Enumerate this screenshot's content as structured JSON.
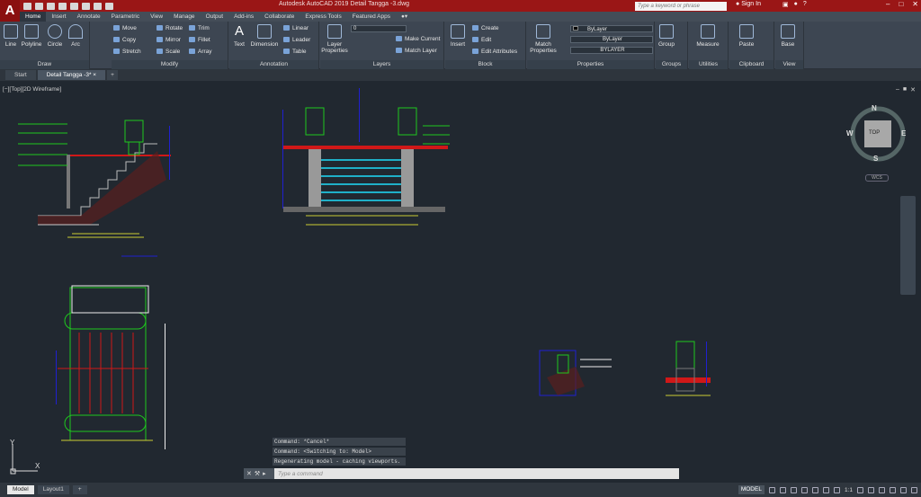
{
  "app": {
    "logo": "A",
    "title": "Autodesk AutoCAD 2019   Detail Tangga -3.dwg",
    "search_placeholder": "Type a keyword or phrase",
    "sign_in": "Sign In"
  },
  "ribbon_tabs": [
    "Home",
    "Insert",
    "Annotate",
    "Parametric",
    "View",
    "Manage",
    "Output",
    "Add-ins",
    "Collaborate",
    "Express Tools",
    "Featured Apps"
  ],
  "draw": {
    "label": "Draw",
    "line": "Line",
    "polyline": "Polyline",
    "circle": "Circle",
    "arc": "Arc"
  },
  "modify": {
    "label": "Modify",
    "move": "Move",
    "rotate": "Rotate",
    "trim": "Trim",
    "copy": "Copy",
    "mirror": "Mirror",
    "fillet": "Fillet",
    "stretch": "Stretch",
    "scale": "Scale",
    "array": "Array"
  },
  "annotation": {
    "label": "Annotation",
    "text": "Text",
    "dimension": "Dimension",
    "linear": "Linear",
    "leader": "Leader",
    "table": "Table"
  },
  "layers": {
    "label": "Layers",
    "properties": "Layer Properties",
    "current_layer": "0",
    "make_current": "Make Current",
    "match_layer": "Match Layer"
  },
  "block": {
    "label": "Block",
    "insert": "Insert",
    "create": "Create",
    "edit": "Edit",
    "edit_attributes": "Edit Attributes"
  },
  "properties": {
    "label": "Properties",
    "match": "Match Properties",
    "color": "ByLayer",
    "linetype": "ByLayer",
    "lineweight": "BYLAYER"
  },
  "groups": {
    "label": "Groups",
    "group": "Group"
  },
  "utilities": {
    "label": "Utilities",
    "measure": "Measure"
  },
  "clipboard": {
    "label": "Clipboard",
    "paste": "Paste"
  },
  "view": {
    "label": "View",
    "base": "Base"
  },
  "doc_tabs": {
    "start": "Start",
    "active": "Detail Tangga -3*"
  },
  "viewport": {
    "label": "[−][Top][2D Wireframe]",
    "cube_top": "TOP",
    "n": "N",
    "s": "S",
    "e": "E",
    "w": "W",
    "wcs": "WCS"
  },
  "command": {
    "history": [
      "Command: *Cancel*",
      "Command:   <Switching to: Model>",
      "Regenerating model - caching viewports."
    ],
    "placeholder": "Type a command"
  },
  "ucs": {
    "x": "X",
    "y": "Y"
  },
  "layout_tabs": [
    "Model",
    "Layout1"
  ],
  "status": {
    "model": "MODEL",
    "scale": "1:1"
  }
}
